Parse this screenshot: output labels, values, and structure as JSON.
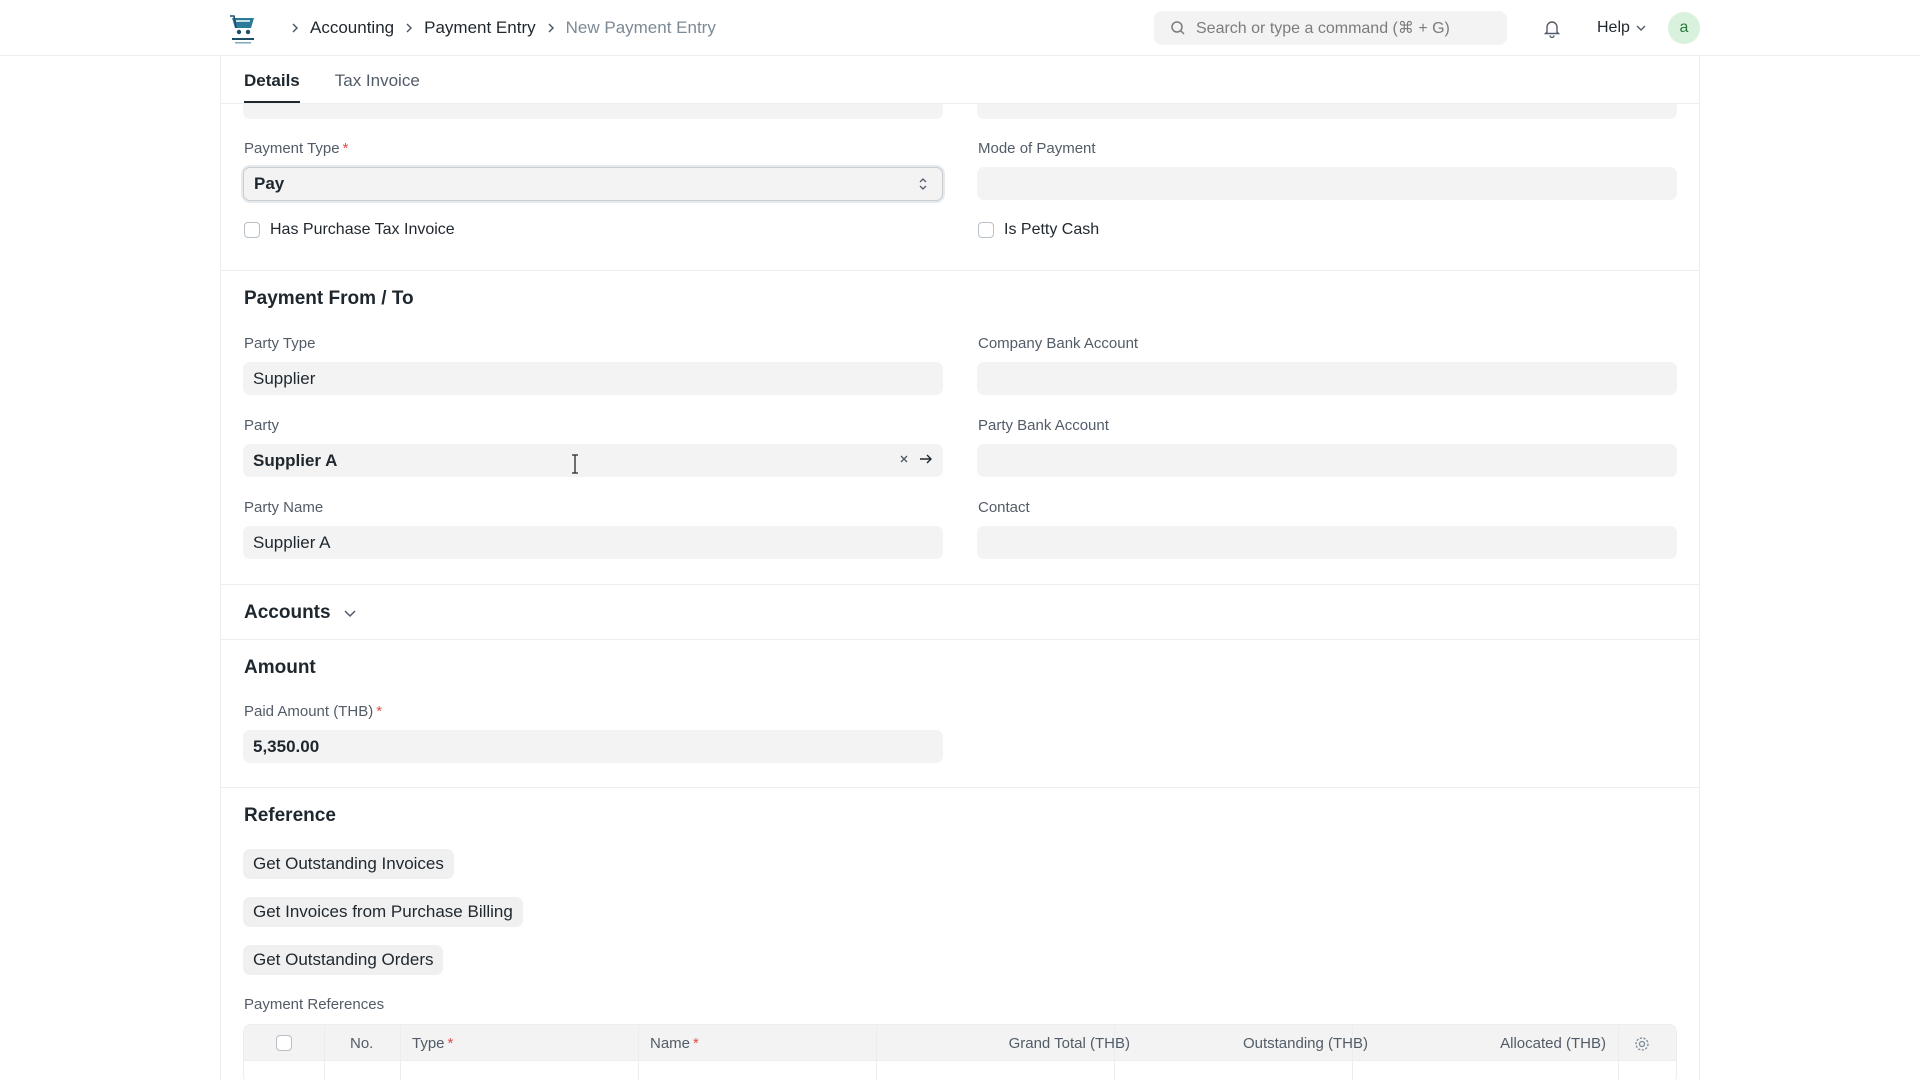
{
  "navbar": {
    "logo_icon": "store-logo-icon",
    "breadcrumbs": [
      "Accounting",
      "Payment Entry",
      "New Payment Entry"
    ],
    "search_placeholder": "Search or type a command (⌘ + G)",
    "help_label": "Help",
    "avatar_initial": "a"
  },
  "tabs": [
    "Details",
    "Tax Invoice"
  ],
  "top_fields": {
    "payment_type_label": "Payment Type",
    "payment_type_value": "Pay",
    "mode_of_payment_label": "Mode of Payment",
    "mode_of_payment_value": "",
    "has_purchase_tax_invoice": "Has Purchase Tax Invoice",
    "is_petty_cash": "Is Petty Cash"
  },
  "payment_from_to": {
    "title": "Payment From / To",
    "party_type_label": "Party Type",
    "party_type_value": "Supplier",
    "company_bank_account_label": "Company Bank Account",
    "party_label": "Party",
    "party_value": "Supplier A",
    "party_bank_account_label": "Party Bank Account",
    "party_name_label": "Party Name",
    "party_name_value": "Supplier A",
    "contact_label": "Contact"
  },
  "accounts": {
    "title": "Accounts"
  },
  "amount": {
    "title": "Amount",
    "paid_amount_label": "Paid Amount (THB)",
    "paid_amount_value": "5,350.00"
  },
  "reference": {
    "title": "Reference",
    "buttons": [
      "Get Outstanding Invoices",
      "Get Invoices from Purchase Billing",
      "Get Outstanding Orders"
    ],
    "payment_references_label": "Payment References",
    "columns": [
      "No.",
      "Type",
      "Name",
      "Grand Total (THB)",
      "Outstanding (THB)",
      "Allocated (THB)"
    ]
  }
}
